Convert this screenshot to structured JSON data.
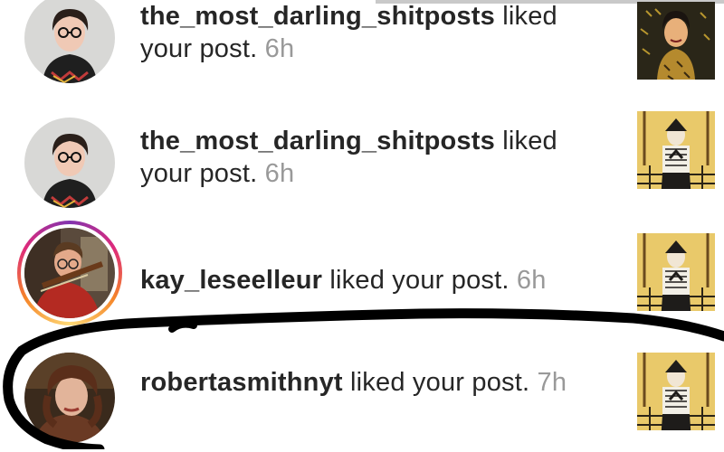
{
  "notifications": [
    {
      "username": "the_most_darling_shitposts",
      "action": " liked your post.",
      "time": "6h",
      "avatar_icon": "woman-glasses-avatar",
      "post_thumb": "portrait-painting-thumbnail"
    },
    {
      "username": "the_most_darling_shitposts",
      "action": " liked your post.",
      "time": "6h",
      "avatar_icon": "woman-glasses-avatar",
      "post_thumb": "gothic-figure-thumbnail"
    },
    {
      "username": "kay_leseelleur",
      "action": " liked your post.",
      "time": "6h",
      "avatar_icon": "violinist-avatar",
      "post_thumb": "gothic-figure-thumbnail",
      "story_ring": true
    },
    {
      "username": "robertasmithnyt",
      "action": " liked your post.",
      "time": "7h",
      "avatar_icon": "pre-raphaelite-portrait-avatar",
      "post_thumb": "gothic-figure-thumbnail"
    }
  ],
  "colors": {
    "username": "#262626",
    "timestamp": "#999999",
    "scribble": "#000000",
    "story_ring_gradient": [
      "#8134af",
      "#dd2a7b",
      "#f58529",
      "#feda77"
    ]
  }
}
